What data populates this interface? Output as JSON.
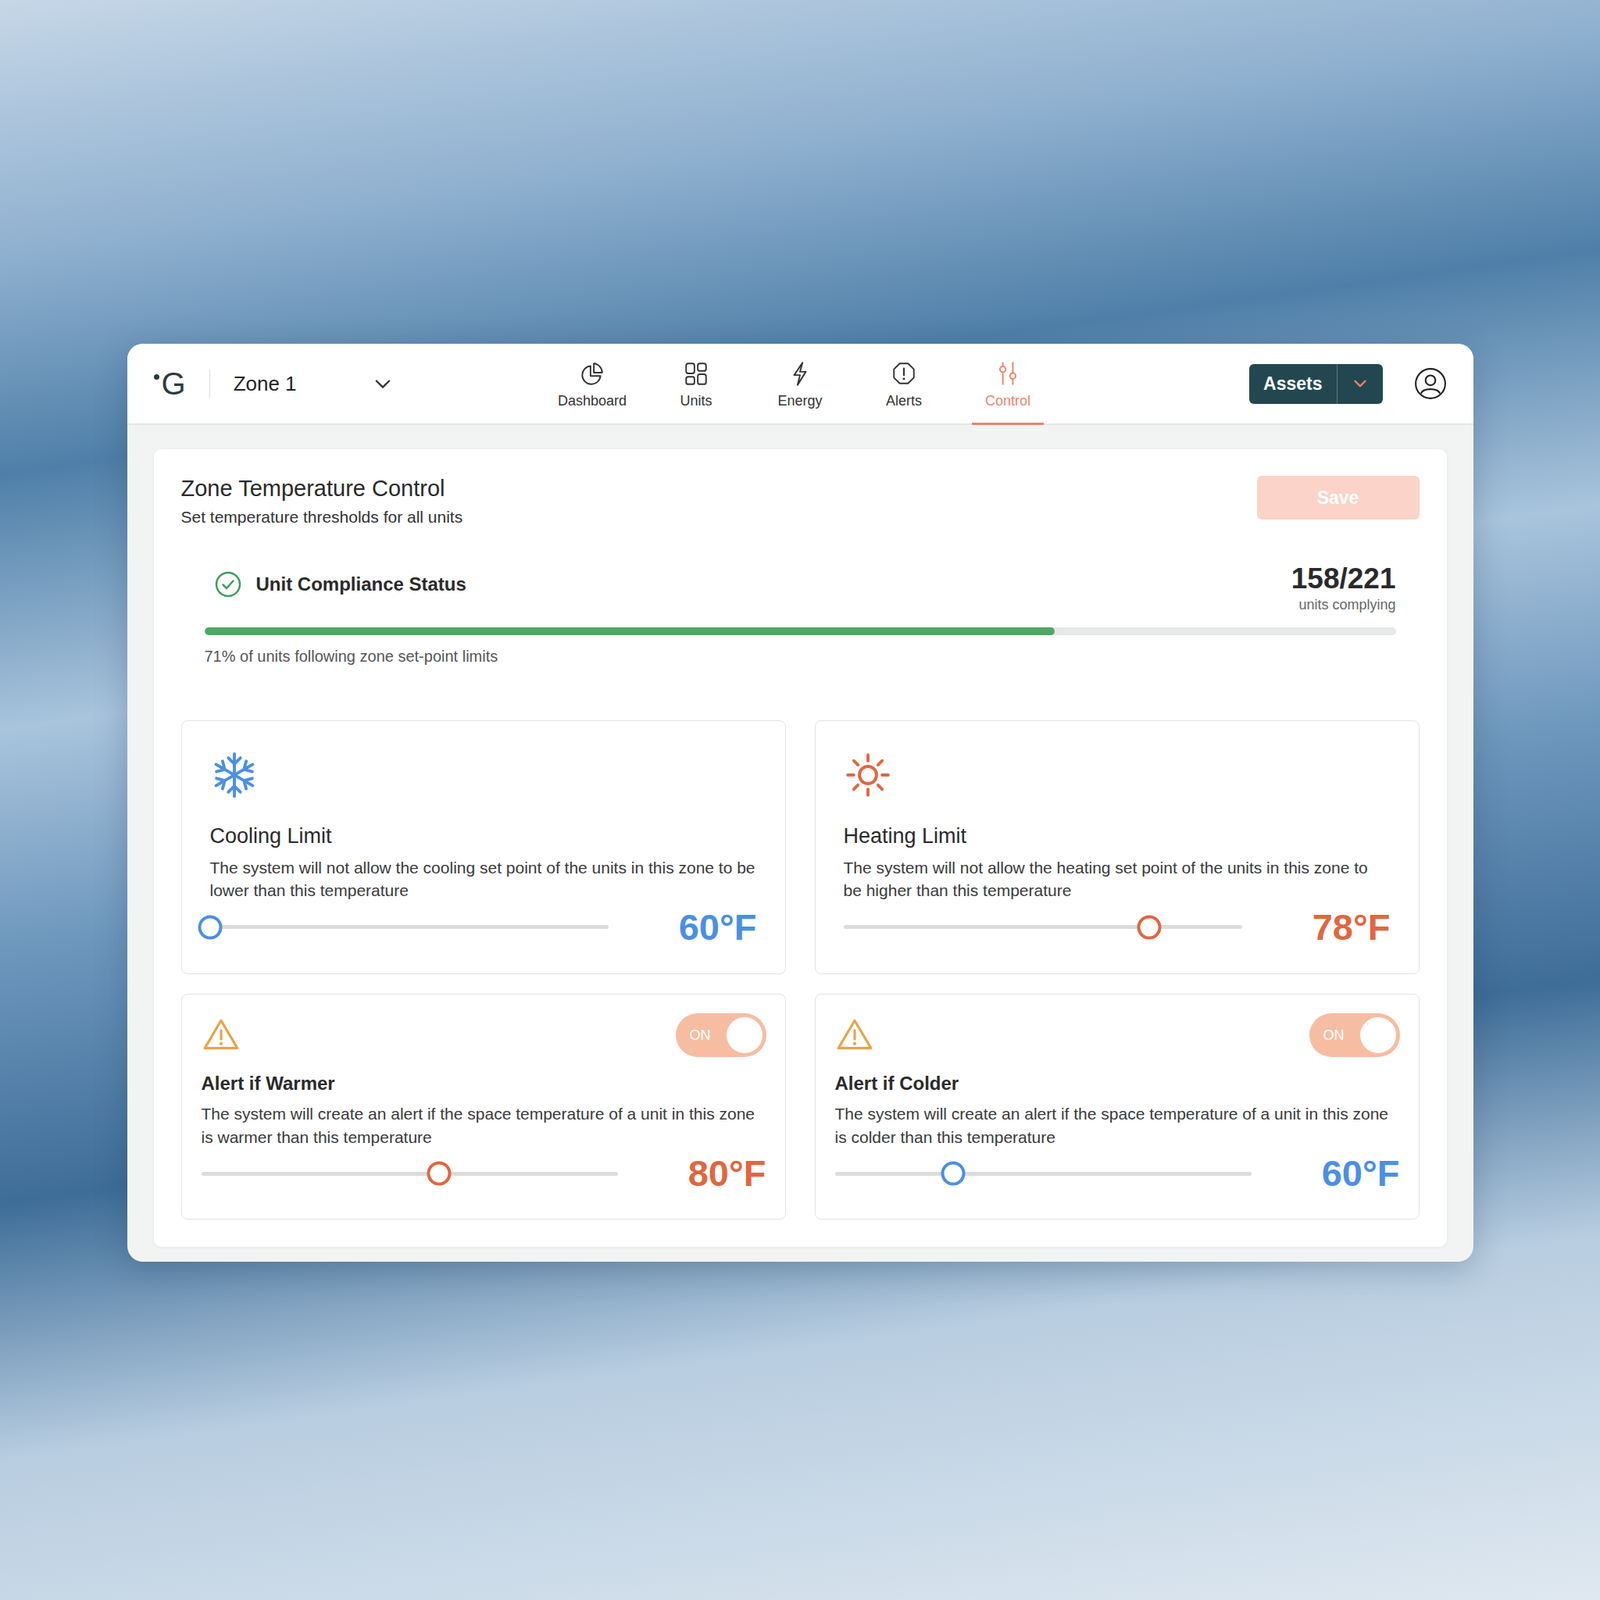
{
  "app": {
    "logo": "G",
    "zone": "Zone 1"
  },
  "nav": [
    {
      "label": "Dashboard",
      "selected": false
    },
    {
      "label": "Units",
      "selected": false
    },
    {
      "label": "Energy",
      "selected": false
    },
    {
      "label": "Alerts",
      "selected": false
    },
    {
      "label": "Control",
      "selected": true
    }
  ],
  "assets_button": "Assets",
  "panel": {
    "title": "Zone Temperature Control",
    "subtitle": "Set temperature thresholds for all units",
    "save_button": {
      "label": "Save",
      "disabled": true
    }
  },
  "compliance": {
    "title": "Unit Compliance Status",
    "count": "158/221",
    "count_label": "units complying",
    "level": 0.714,
    "caption": "71% of units following zone set-point limits"
  },
  "limits": [
    {
      "kind": "cooling",
      "title": "Cooling Limit",
      "description": "The system will not allow the cooling set point of the units in this zone to be lower than this temperature",
      "reading": "60°F",
      "level": 0,
      "color": "#4a90e2"
    },
    {
      "kind": "heating",
      "title": "Heating Limit",
      "description": "The system will not allow the heating set point of the units in this zone to be higher than this temperature",
      "reading": "78°F",
      "level": 0.767,
      "color": "#e0673f"
    }
  ],
  "alerts": [
    {
      "title": "Alert if Warmer",
      "description": "The system will create an alert if the space temperature of a unit in this zone is warmer than this temperature",
      "toggle": "ON",
      "on": true,
      "reading": "80°F",
      "level": 0.572,
      "color": "#e0673f"
    },
    {
      "title": "Alert if Colder",
      "description": "The system will create an alert if the space temperature of a unit in this zone is colder than this temperature",
      "toggle": "ON",
      "on": true,
      "reading": "60°F",
      "level": 0.285,
      "color": "#4a90e2"
    }
  ]
}
